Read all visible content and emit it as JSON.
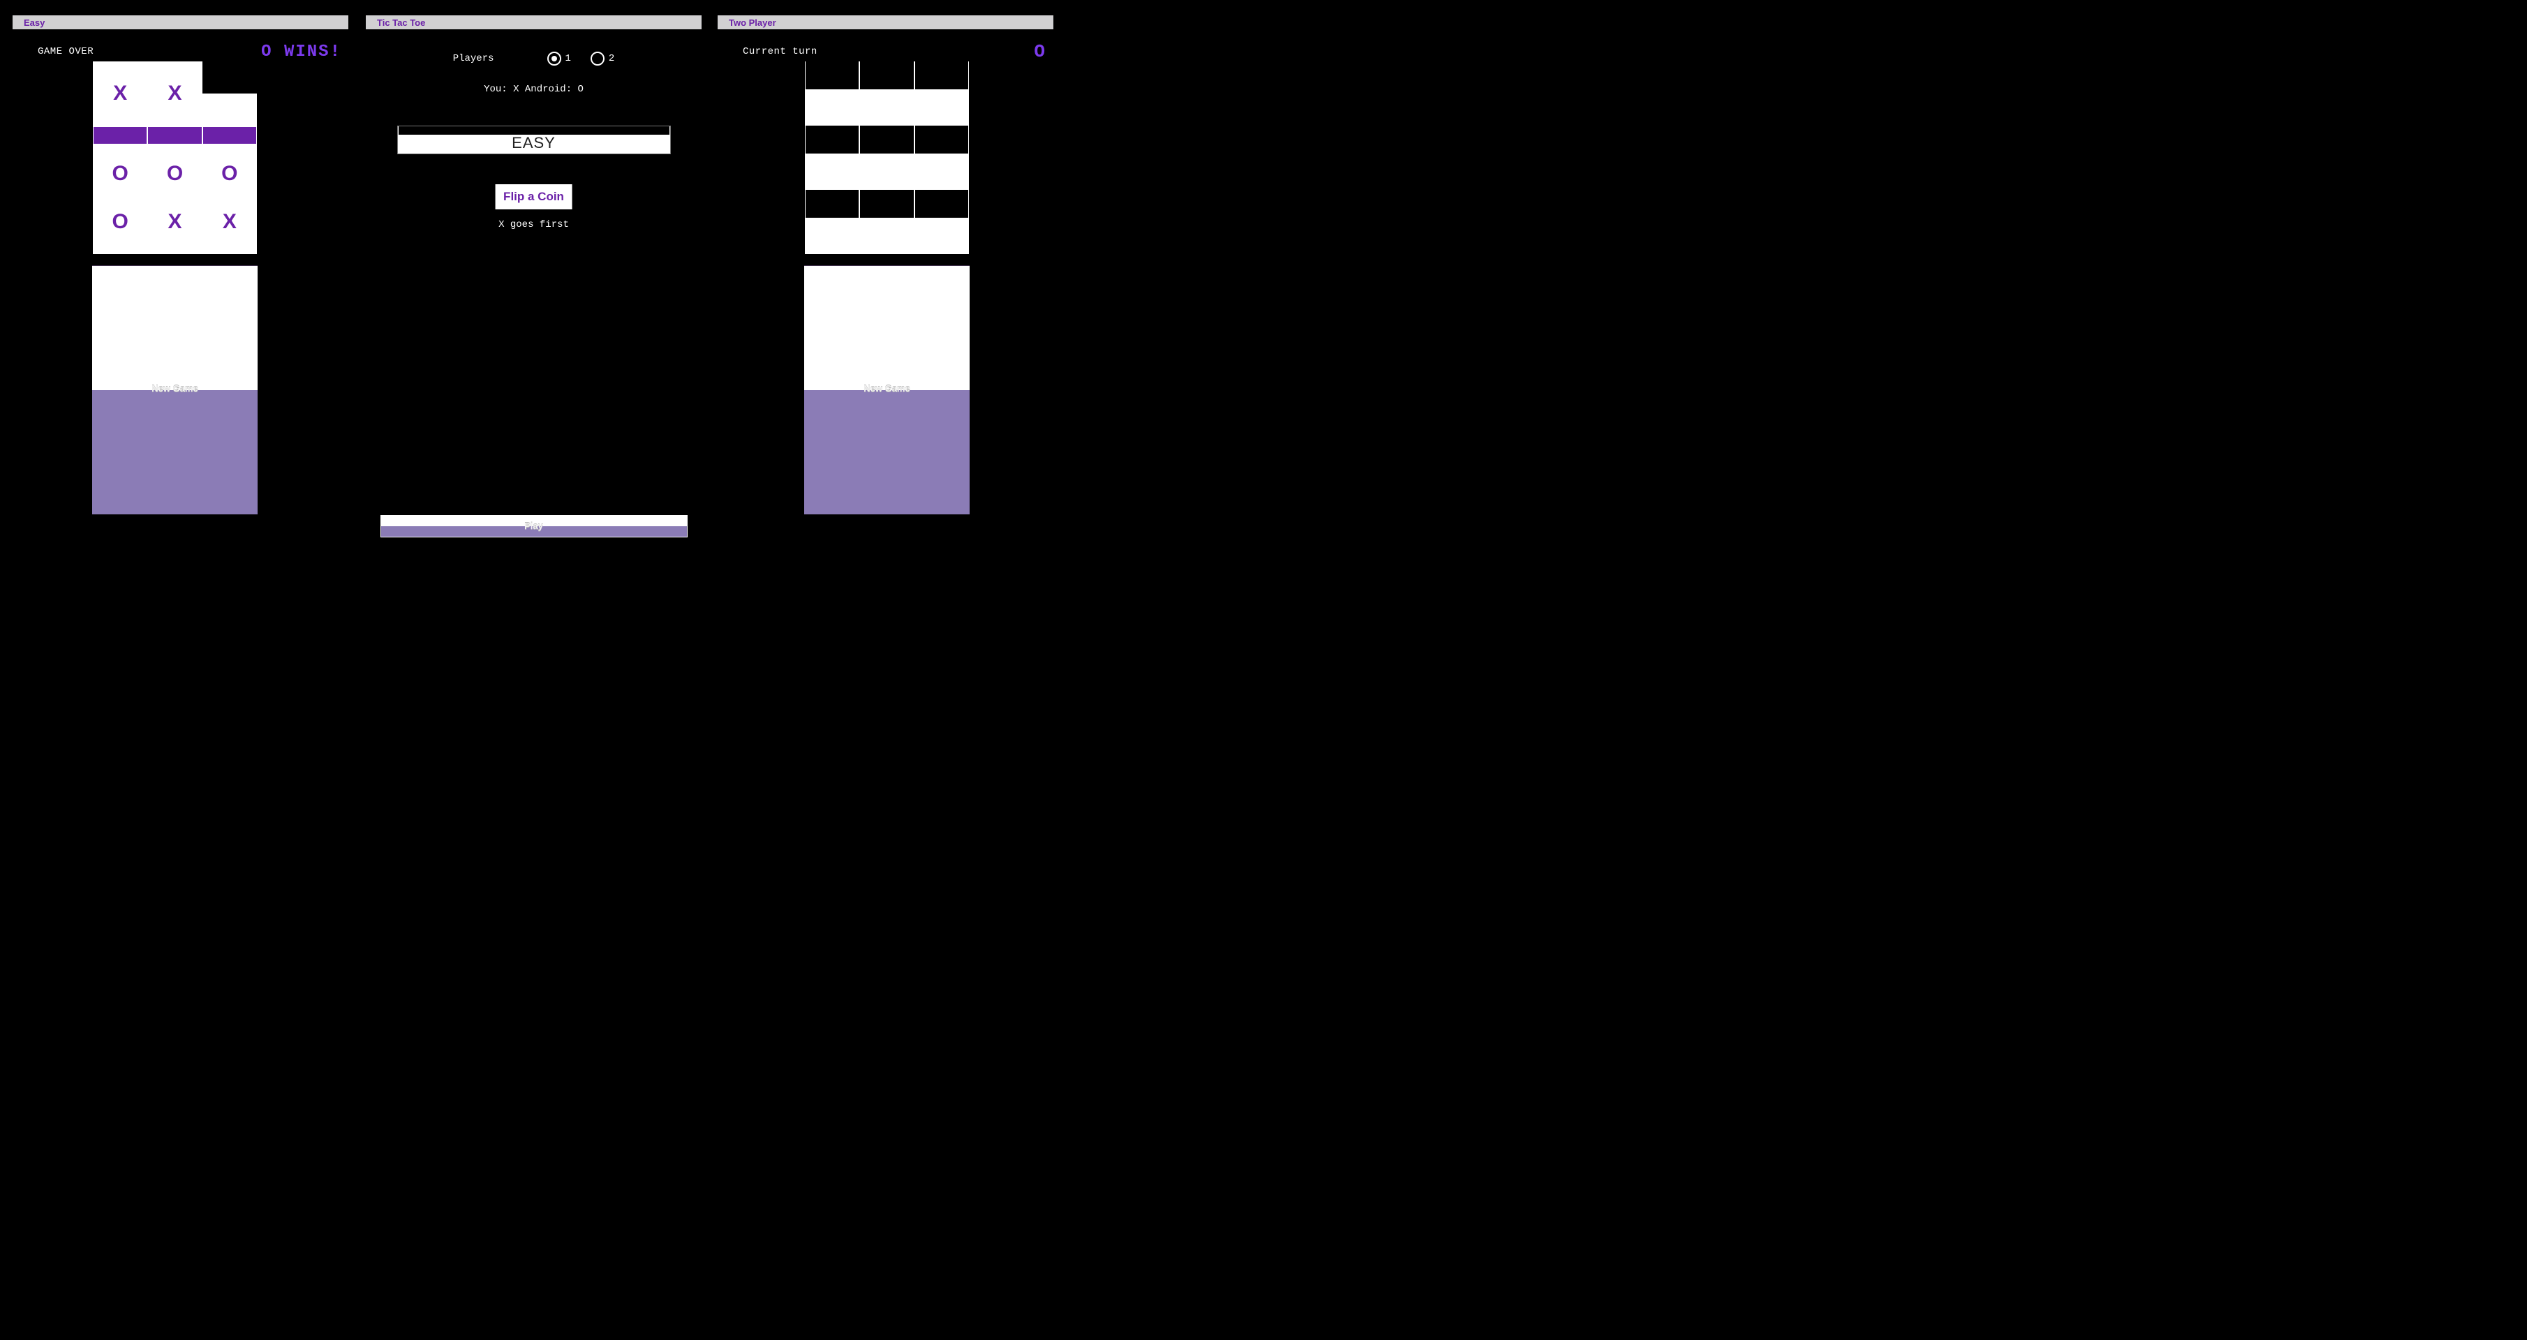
{
  "bars": {
    "left": "Easy",
    "center": "Tic Tac Toe",
    "right": "Two Player"
  },
  "left": {
    "status_label": "GAME OVER",
    "status_value": "O WINS!",
    "board": [
      [
        "X",
        "X",
        ""
      ],
      [
        "O",
        "O",
        "O"
      ],
      [
        "O",
        "X",
        "X"
      ]
    ],
    "new_game_label": "New Game"
  },
  "center": {
    "players_label": "Players",
    "radio1_label": "1",
    "radio2_label": "2",
    "selected_players": 1,
    "assignment_text": "You: X Android: O",
    "difficulty_value": "EASY",
    "flip_label": "Flip a Coin",
    "goes_first_text": "X goes first",
    "play_label": "Play"
  },
  "right": {
    "status_label": "Current turn",
    "status_value": "O",
    "board": [
      [
        "",
        "",
        ""
      ],
      [
        "",
        "",
        ""
      ],
      [
        "",
        "",
        ""
      ]
    ],
    "new_game_label": "New Game"
  }
}
